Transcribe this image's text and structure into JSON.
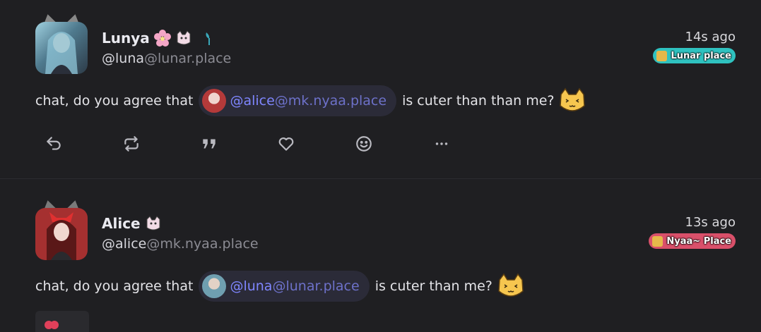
{
  "notes": [
    {
      "display_name": "Lunya",
      "user": "@luna",
      "host": "@lunar.place",
      "time": "14s ago",
      "instance_name": "Lunar place",
      "instance_color": "#2fc2c0",
      "avatar_color": "#6b8fa0",
      "text_before": "chat, do you agree that",
      "mention_user": "@alice",
      "mention_host": "@mk.nyaa.place",
      "text_after": "is cuter than than me?",
      "actions": [
        "reply-icon",
        "renote-icon",
        "quote-icon",
        "heart-icon",
        "emoji-reaction-icon",
        "more-icon"
      ]
    },
    {
      "display_name": "Alice",
      "user": "@alice",
      "host": "@mk.nyaa.place",
      "time": "13s ago",
      "instance_name": "Nyaa~ Place",
      "instance_color": "#d9506a",
      "avatar_color": "#a83232",
      "text_before": "chat, do you agree that",
      "mention_user": "@luna",
      "mention_host": "@lunar.place",
      "text_after": "is cuter than me?"
    }
  ]
}
